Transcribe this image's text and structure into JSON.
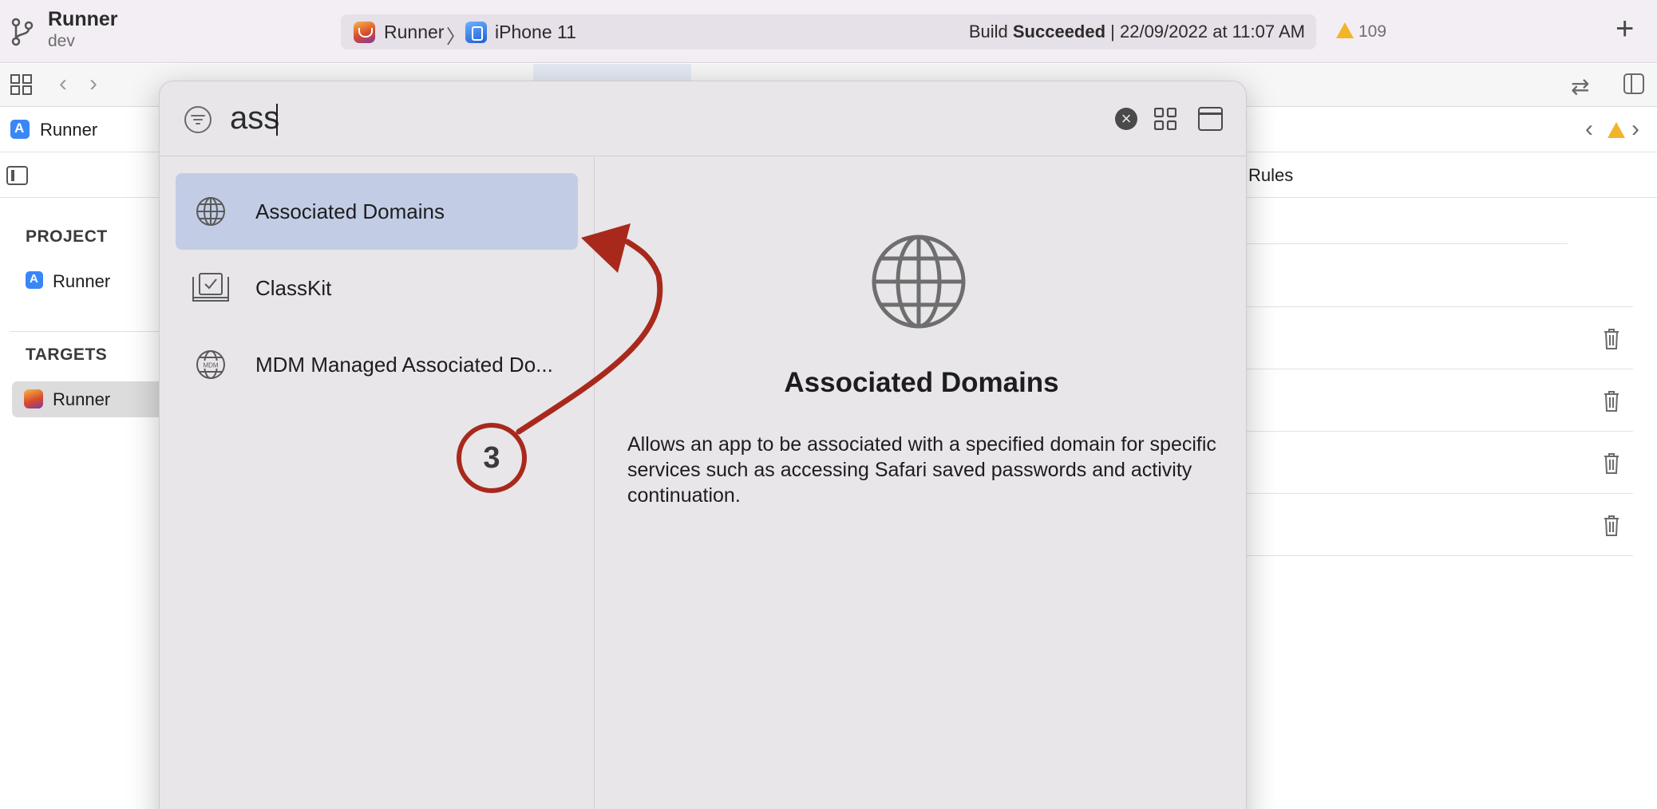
{
  "titlebar": {
    "project_name": "Runner",
    "branch": "dev",
    "scheme": "Runner",
    "device": "iPhone 11",
    "build_prefix": "Build ",
    "build_status": "Succeeded",
    "build_time": " | 22/09/2022 at 11:07 AM",
    "warning_count": "109"
  },
  "jumpbar": {
    "project_label": "Runner"
  },
  "settings_tabs": {
    "rules_label": "Rules"
  },
  "navigator": {
    "project_section": "PROJECT",
    "project_item": "Runner",
    "targets_section": "TARGETS",
    "target_item": "Runner"
  },
  "capability_picker": {
    "search_value": "ass",
    "results": [
      {
        "label": "Associated Domains",
        "icon": "globe-icon",
        "selected": true
      },
      {
        "label": "ClassKit",
        "icon": "classkit-icon",
        "selected": false
      },
      {
        "label": "MDM Managed Associated Do...",
        "icon": "mdm-globe-icon",
        "selected": false
      }
    ],
    "detail": {
      "icon": "globe-icon",
      "title": "Associated Domains",
      "description": "Allows an app to be associated with a specified domain for specific services such as accessing Safari saved passwords and activity continuation."
    }
  },
  "annotation": {
    "step_number": "3",
    "color": "#a8291c"
  },
  "colors": {
    "selection": "#c2cde5",
    "warning": "#f2b428",
    "popup_background": "#e8e6e9"
  }
}
